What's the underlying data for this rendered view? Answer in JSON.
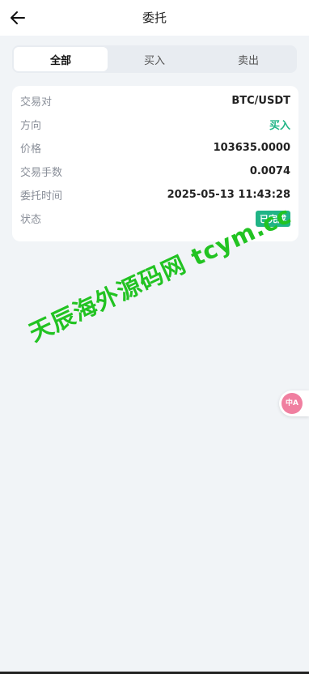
{
  "header": {
    "title": "委托"
  },
  "tabs": [
    {
      "label": "全部",
      "active": true
    },
    {
      "label": "买入",
      "active": false
    },
    {
      "label": "卖出",
      "active": false
    }
  ],
  "order": {
    "rows": [
      {
        "label": "交易对",
        "value": "BTC/USDT"
      },
      {
        "label": "方向",
        "value": "买入"
      },
      {
        "label": "价格",
        "value": "103635.0000"
      },
      {
        "label": "交易手数",
        "value": "0.0074"
      },
      {
        "label": "委托时间",
        "value": "2025-05-13 11:43:28"
      },
      {
        "label": "状态",
        "value": "已完成"
      }
    ]
  },
  "watermark": {
    "text": "天辰海外源码网 tcym.cc"
  },
  "translate_fab": {
    "icon": "translate-icon",
    "text": "中A"
  },
  "colors": {
    "accent": "#20b486",
    "background": "#f1f4f7",
    "watermark": "#22c322",
    "fab": "#f07fa0"
  }
}
